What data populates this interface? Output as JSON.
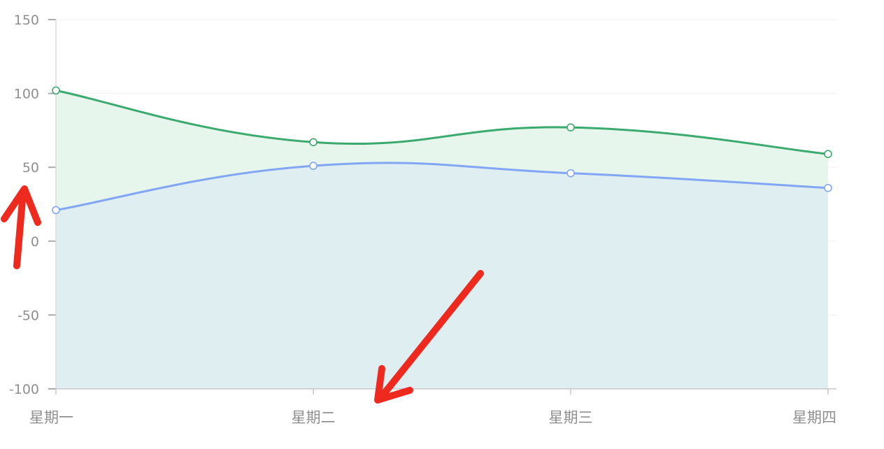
{
  "chart_data": {
    "type": "area",
    "categories": [
      "星期一",
      "星期二",
      "星期三",
      "星期四"
    ],
    "ylim": [
      -100,
      150
    ],
    "yticks": [
      150,
      100,
      50,
      0,
      -50,
      -100
    ],
    "grid": true,
    "series": [
      {
        "values": [
          102,
          67,
          77,
          59
        ],
        "color": "#3aaa6e",
        "fill": "#e7f6ec"
      },
      {
        "values": [
          21,
          51,
          46,
          36
        ],
        "color": "#82a6f5",
        "fill": "#deeef1"
      }
    ]
  },
  "annotations": [
    {
      "type": "arrow",
      "color": "#ee2a1f",
      "points_to": "y-axis 50 tick"
    },
    {
      "type": "arrow",
      "color": "#ee2a1f",
      "points_to": "x-axis between 星期二 and 星期三"
    }
  ]
}
